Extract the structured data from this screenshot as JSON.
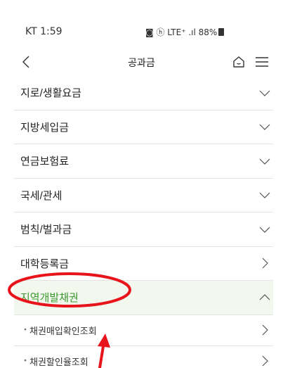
{
  "status_bar": {
    "time": "KT 1:59",
    "indicators": "◙ ⓗ LTE⁺ .ıl 88%"
  },
  "header": {
    "title": "공과금",
    "back_icon": "chevron-left-icon",
    "home_icon": "home-icon",
    "menu_icon": "hamburger-menu-icon"
  },
  "menu": {
    "items": [
      {
        "label": "지로/생활요금",
        "icon": "chevron-down-icon"
      },
      {
        "label": "지방세입금",
        "icon": "chevron-down-icon"
      },
      {
        "label": "연금보험료",
        "icon": "chevron-down-icon"
      },
      {
        "label": "국세/관세",
        "icon": "chevron-down-icon"
      },
      {
        "label": "범칙/벌과금",
        "icon": "chevron-down-icon"
      },
      {
        "label": "대학등록금",
        "icon": "chevron-right-icon"
      },
      {
        "label": "지역개발채권",
        "icon": "chevron-up-icon",
        "expanded": true
      }
    ],
    "subitems": [
      {
        "bullet": "•",
        "label": "채권매입확인조회",
        "icon": "chevron-right-icon"
      },
      {
        "bullet": "•",
        "label": "채권할인율조회",
        "icon": "chevron-right-icon"
      }
    ]
  },
  "colors": {
    "active_text": "#3a9a2f",
    "active_bg": "#f3f8ee",
    "annotation": "#e8141c"
  }
}
